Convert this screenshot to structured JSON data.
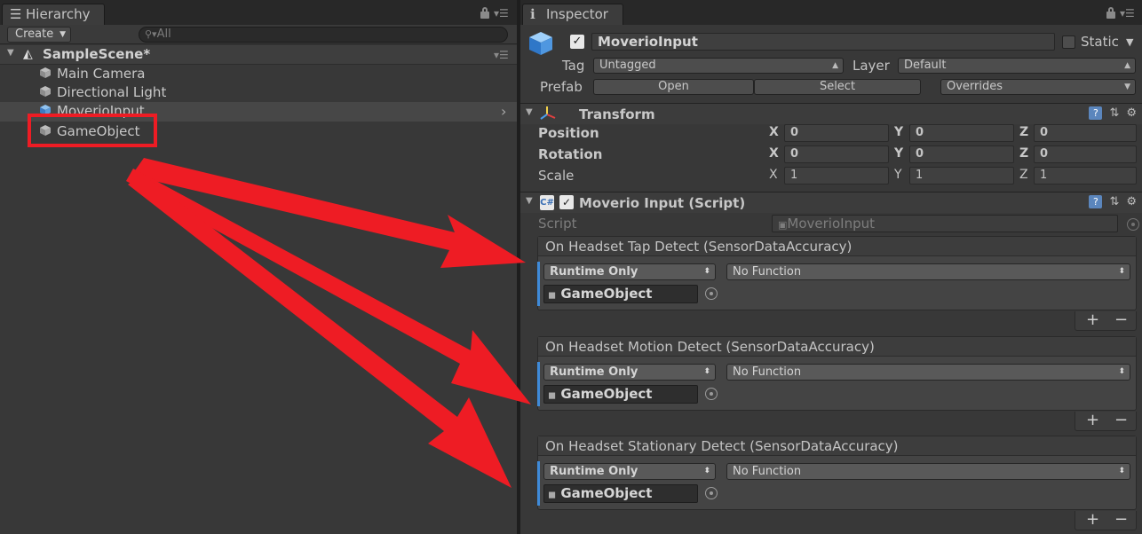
{
  "hierarchy": {
    "tab_label": "Hierarchy",
    "create_label": "Create",
    "search_placeholder": "All",
    "scene_name": "SampleScene*",
    "items": [
      "Main Camera",
      "Directional Light",
      "MoverioInput",
      "GameObject"
    ]
  },
  "inspector": {
    "tab_label": "Inspector",
    "object_name": "MoverioInput",
    "static_label": "Static",
    "tag_label": "Tag",
    "tag_value": "Untagged",
    "layer_label": "Layer",
    "layer_value": "Default",
    "prefab_label": "Prefab",
    "prefab_open": "Open",
    "prefab_select": "Select",
    "prefab_overrides": "Overrides",
    "transform": {
      "title": "Transform",
      "rows": [
        {
          "label": "Position",
          "x": "0",
          "y": "0",
          "z": "0"
        },
        {
          "label": "Rotation",
          "x": "0",
          "y": "0",
          "z": "0"
        },
        {
          "label": "Scale",
          "x": "1",
          "y": "1",
          "z": "1"
        }
      ],
      "axis_x": "X",
      "axis_y": "Y",
      "axis_z": "Z"
    },
    "script_component": {
      "title": "Moverio Input (Script)",
      "script_label": "Script",
      "script_value": "MoverioInput"
    },
    "events": [
      {
        "title": "On Headset Tap Detect (SensorDataAccuracy)",
        "mode": "Runtime Only",
        "function": "No Function",
        "object": "GameObject"
      },
      {
        "title": "On Headset Motion Detect (SensorDataAccuracy)",
        "mode": "Runtime Only",
        "function": "No Function",
        "object": "GameObject"
      },
      {
        "title": "On Headset Stationary Detect (SensorDataAccuracy)",
        "mode": "Runtime Only",
        "function": "No Function",
        "object": "GameObject"
      }
    ],
    "plus": "+",
    "minus": "−"
  },
  "colors": {
    "annotation_red": "#ee1c24",
    "panel_bg": "#383838",
    "selection_blue": "#3f8ad8"
  }
}
